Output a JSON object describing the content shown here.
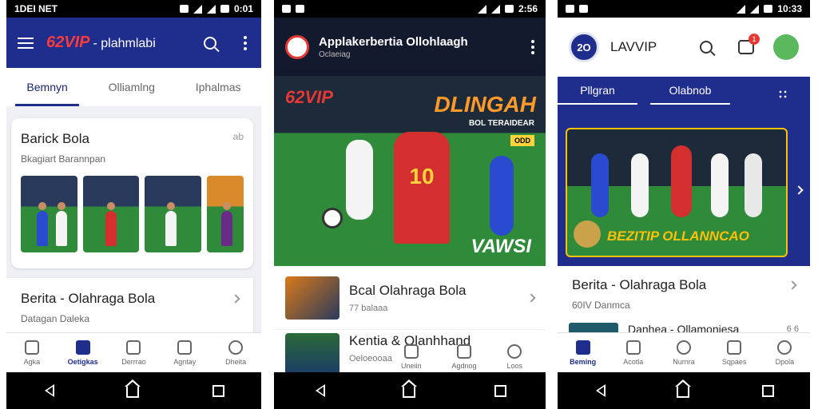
{
  "screen1": {
    "status": {
      "left": "1DEI NET",
      "time": "0:01"
    },
    "brand": {
      "logo": "62VIP",
      "subtitle": "- plahmlabi"
    },
    "tabs": [
      "Bemnyn",
      "Olliamlng",
      "Iphalmas"
    ],
    "card1": {
      "title": "Barick Bola",
      "subtitle": "Bkagiart Barannpan",
      "aside": "ab"
    },
    "card2": {
      "title": "Berita - Olahraga Bola",
      "subtitle": "Datagan Daleka"
    },
    "bottomnav": [
      "Agka",
      "Oetigkas",
      "Derrrao",
      "Agntay",
      "Dheita"
    ]
  },
  "screen2": {
    "status": {
      "time": "2:56"
    },
    "header": {
      "title": "Applakerbertia Ollohlaagh",
      "subtitle": "Oclaeiag"
    },
    "hero": {
      "logo": "62VIP",
      "headline": "DLINGAH",
      "sub": "BOL TERAIDEAR",
      "badge": "ODD",
      "jersey": "10",
      "caption": "VAWSI"
    },
    "items": [
      {
        "title": "Bcal Olahraga Bola",
        "meta": "77 balaaa"
      },
      {
        "title": "Kentia & Olanhhand",
        "meta": "Oeloeooaa"
      }
    ],
    "bottomnav": [
      "Uneiin",
      "Agdnog",
      "Loos"
    ]
  },
  "screen3": {
    "status": {
      "time": "10:33"
    },
    "header": {
      "logo": "2O",
      "brand": "LAVVIP",
      "notif_count": "1"
    },
    "tabs": [
      "Pllgran",
      "Olabnob"
    ],
    "banner": {
      "caption": "BEZITIP OLLANNCAO"
    },
    "card": {
      "title": "Berita - Olahraga Bola",
      "subtitle": "60IV Danmca"
    },
    "peek": {
      "title": "Danhea - Ollamoniesa",
      "aside": "6 6"
    },
    "bottomnav": [
      "Beming",
      "Acotla",
      "Nurnra",
      "Sqpaes",
      "Dpola"
    ]
  },
  "colors": {
    "primary": "#1f2d8c",
    "accent": "#e53935",
    "pitch": "#2f8a3a",
    "notif": "#e53935",
    "avatar": "#5cb85c"
  }
}
